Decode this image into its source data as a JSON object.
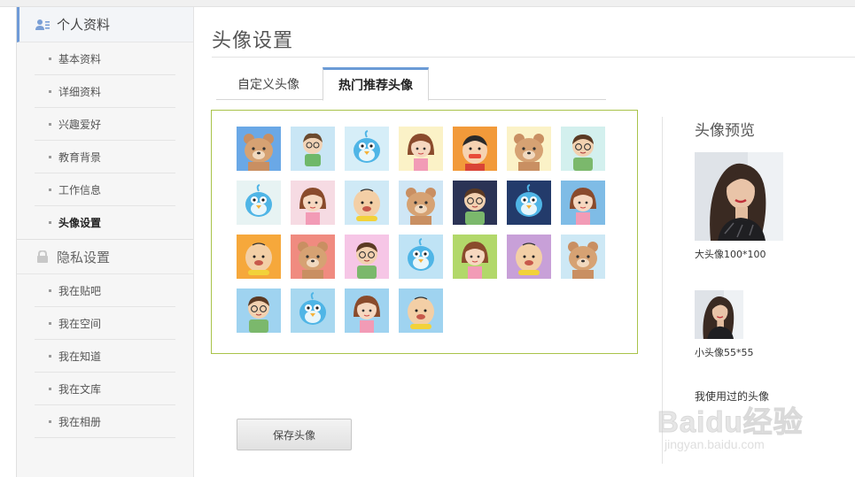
{
  "sidebar": {
    "profile_section": "个人资料",
    "profile_items": [
      {
        "label": "基本资料"
      },
      {
        "label": "详细资料"
      },
      {
        "label": "兴趣爱好"
      },
      {
        "label": "教育背景"
      },
      {
        "label": "工作信息"
      },
      {
        "label": "头像设置"
      }
    ],
    "privacy_section": "隐私设置",
    "privacy_items": [
      {
        "label": "我在贴吧"
      },
      {
        "label": "我在空间"
      },
      {
        "label": "我在知道"
      },
      {
        "label": "我在文库"
      },
      {
        "label": "我在相册"
      }
    ],
    "icons": {
      "profile": "user-card-icon",
      "privacy": "lock-icon"
    }
  },
  "main": {
    "title": "头像设置",
    "tabs": [
      {
        "label": "自定义头像"
      },
      {
        "label": "热门推荐头像"
      }
    ],
    "save_button": "保存头像"
  },
  "preview": {
    "title": "头像预览",
    "big_label": "大头像100*100",
    "small_label": "小头像55*55",
    "used_label": "我使用过的头像"
  },
  "watermark": {
    "text": "Baidu经验",
    "url": "jingyan.baidu.com"
  },
  "avatars": [
    {
      "kind": "bear",
      "bg": "#6aa8e6"
    },
    {
      "kind": "girl-glasses",
      "bg": "#c9e6f5"
    },
    {
      "kind": "bird",
      "bg": "#d6eef8"
    },
    {
      "kind": "girl",
      "bg": "#fbf2c7"
    },
    {
      "kind": "boy-red",
      "bg": "#f29a3a"
    },
    {
      "kind": "bear",
      "bg": "#fbf2c7"
    },
    {
      "kind": "boy-glasses",
      "bg": "#d3f0ee"
    },
    {
      "kind": "bird",
      "bg": "#e7f3f3"
    },
    {
      "kind": "girl",
      "bg": "#f6dbe3"
    },
    {
      "kind": "bald",
      "bg": "#cfe9f6"
    },
    {
      "kind": "bear",
      "bg": "#cfe6f5"
    },
    {
      "kind": "boy-glasses",
      "bg": "#2b3355"
    },
    {
      "kind": "bird",
      "bg": "#233b6b"
    },
    {
      "kind": "girl",
      "bg": "#7fbce6"
    },
    {
      "kind": "bald",
      "bg": "#f6a83b"
    },
    {
      "kind": "bear",
      "bg": "#f08b80"
    },
    {
      "kind": "boy-glasses",
      "bg": "#f6c6e6"
    },
    {
      "kind": "bird",
      "bg": "#bfe3f5"
    },
    {
      "kind": "girl",
      "bg": "#b2d86a"
    },
    {
      "kind": "bald",
      "bg": "#c8a0d8"
    },
    {
      "kind": "bear",
      "bg": "#cde8f5"
    },
    {
      "kind": "boy-glasses",
      "bg": "#9fd3f0"
    },
    {
      "kind": "bird",
      "bg": "#a8d8f0"
    },
    {
      "kind": "girl",
      "bg": "#9fd3f0"
    },
    {
      "kind": "bald",
      "bg": "#9fd3f0"
    }
  ]
}
